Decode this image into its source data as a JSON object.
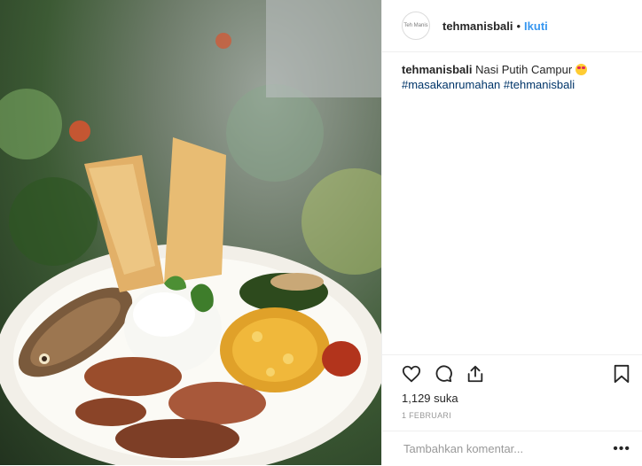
{
  "post": {
    "image_alt": "Nasi Putih Campur plate",
    "avatar_text": "Teh Manis"
  },
  "header": {
    "username": "tehmanisbali",
    "separator": "•",
    "follow_label": "Ikuti"
  },
  "caption": {
    "username": "tehmanisbali",
    "text": "Nasi Putih Campur",
    "emoji": "heart-eyes-emoji",
    "hashtags": [
      "#masakanrumahan",
      "#tehmanisbali"
    ]
  },
  "actions": {
    "icons": [
      "heart-icon",
      "comment-icon",
      "share-icon",
      "bookmark-icon"
    ]
  },
  "stats": {
    "likes": "1,129 suka",
    "date": "1 FEBRUARI"
  },
  "comment": {
    "placeholder": "Tambahkan komentar...",
    "more": "•••"
  },
  "colors": {
    "link": "#3897f0",
    "hashtag": "#003569",
    "text": "#262626",
    "muted": "#999999"
  }
}
